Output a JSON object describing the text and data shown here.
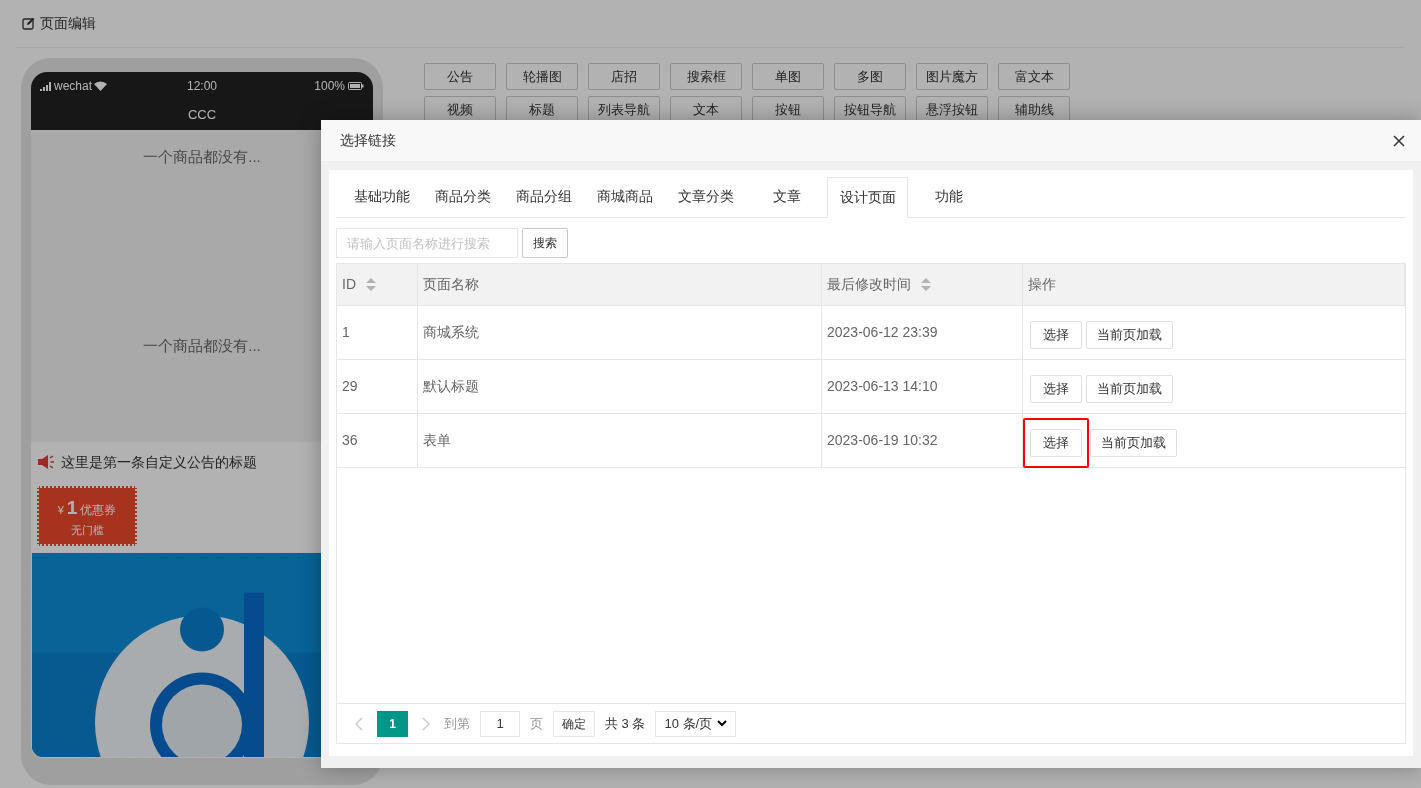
{
  "header": {
    "title": "页面编辑"
  },
  "phone": {
    "status": {
      "carrier": "wechat",
      "time": "12:00",
      "battery": "100%"
    },
    "title": "CCC",
    "blocks": [
      {
        "kind": "empty",
        "text": "一个商品都没有..."
      },
      {
        "kind": "empty",
        "text": "一个商品都没有..."
      },
      {
        "kind": "notice",
        "text": "这里是第一条自定义公告的标题"
      },
      {
        "kind": "coupon",
        "currency": "¥",
        "amount": "1",
        "label": "优惠券",
        "condition": "无门槛"
      },
      {
        "kind": "picture"
      }
    ]
  },
  "components": [
    "公告",
    "轮播图",
    "店招",
    "搜索框",
    "单图",
    "多图",
    "图片魔方",
    "富文本",
    "视频",
    "标题",
    "列表导航",
    "文本",
    "按钮",
    "按钮导航",
    "悬浮按钮",
    "辅助线"
  ],
  "dialog": {
    "title": "选择链接",
    "tabs": [
      {
        "label": "基础功能",
        "selected": false
      },
      {
        "label": "商品分类",
        "selected": false
      },
      {
        "label": "商品分组",
        "selected": false
      },
      {
        "label": "商城商品",
        "selected": false
      },
      {
        "label": "文章分类",
        "selected": false
      },
      {
        "label": "文章",
        "selected": false
      },
      {
        "label": "设计页面",
        "selected": true
      },
      {
        "label": "功能",
        "selected": false
      }
    ],
    "search": {
      "placeholder": "请输入页面名称进行搜索",
      "button": "搜索"
    },
    "table": {
      "columns": [
        {
          "label": "ID",
          "sortable": true
        },
        {
          "label": "页面名称",
          "sortable": false
        },
        {
          "label": "最后修改时间",
          "sortable": true
        },
        {
          "label": "操作",
          "sortable": false
        }
      ],
      "rows": [
        {
          "id": "1",
          "name": "商城系统",
          "modified": "2023-06-12 23:39",
          "select": "选择",
          "load": "当前页加载",
          "highlighted": false
        },
        {
          "id": "29",
          "name": "默认标题",
          "modified": "2023-06-13 14:10",
          "select": "选择",
          "load": "当前页加载",
          "highlighted": false
        },
        {
          "id": "36",
          "name": "表单",
          "modified": "2023-06-19 10:32",
          "select": "选择",
          "load": "当前页加载",
          "highlighted": true
        }
      ]
    },
    "pagination": {
      "current": "1",
      "goto_label": "到第",
      "goto_value": "1",
      "page_label": "页",
      "confirm": "确定",
      "total": "共 3 条",
      "page_size": "10 条/页"
    }
  }
}
